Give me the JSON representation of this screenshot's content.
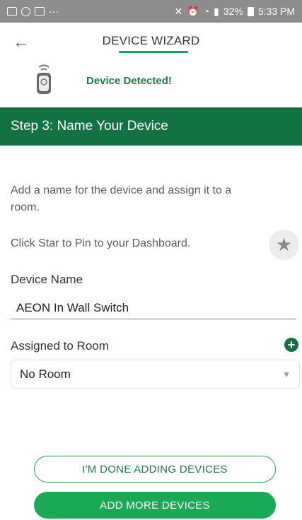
{
  "status_bar": {
    "left_icons": [
      "gallery-icon",
      "whatsapp-icon",
      "gmail-icon"
    ],
    "overflow": "···",
    "battery": "32%",
    "time": "5:33 PM"
  },
  "header": {
    "title": "DEVICE WIZARD",
    "accent_color": "#1a9f56"
  },
  "detected": {
    "text": "Device Detected!",
    "icon": "smart-plug-icon"
  },
  "step": {
    "title": "Step 3: Name Your Device",
    "color": "#137242"
  },
  "form": {
    "description": "Add a name for the device and assign it to a room.",
    "star_hint": "Click Star to Pin to your Dashboard.",
    "device_name_label": "Device Name",
    "device_name_value": "AEON In Wall Switch",
    "room_label": "Assigned to Room",
    "room_value": "No Room"
  },
  "buttons": {
    "done": "I'M DONE ADDING DEVICES",
    "more": "ADD MORE DEVICES"
  }
}
